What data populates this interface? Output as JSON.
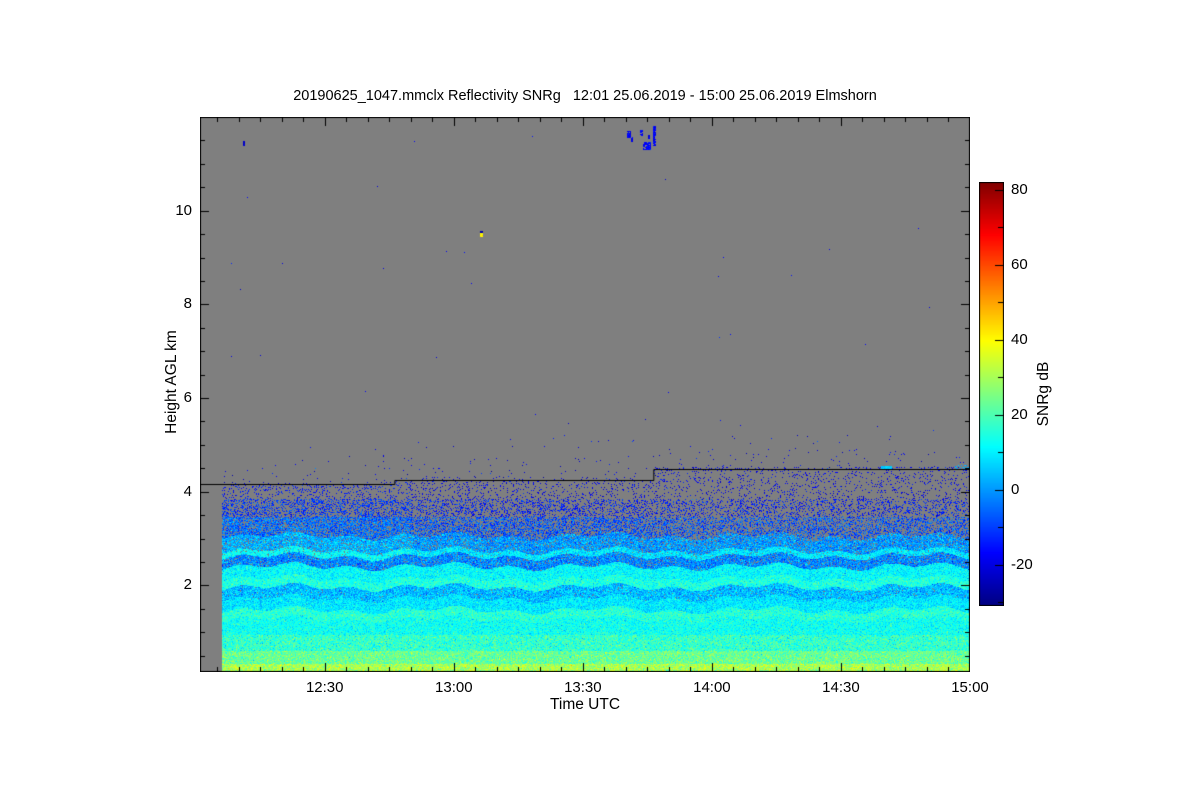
{
  "chart_data": {
    "type": "heatmap",
    "title": "20190625_1047.mmclx Reflectivity SNRg   12:01 25.06.2019 - 15:00 25.06.2019 Elmshorn",
    "xlabel": "Time UTC",
    "ylabel": "Height AGL km",
    "x_axis": {
      "start_min": 721,
      "end_min": 900,
      "minor_step_min": 5,
      "major_ticks": [
        {
          "label": "12:30",
          "min": 750
        },
        {
          "label": "13:00",
          "min": 780
        },
        {
          "label": "13:30",
          "min": 810
        },
        {
          "label": "14:00",
          "min": 840
        },
        {
          "label": "14:30",
          "min": 870
        },
        {
          "label": "15:00",
          "min": 900
        }
      ]
    },
    "y_axis": {
      "min_km": 0.15,
      "max_km": 12.0,
      "minor_step_km": 0.5,
      "major_ticks": [
        {
          "label": "2",
          "km": 2
        },
        {
          "label": "4",
          "km": 4
        },
        {
          "label": "6",
          "km": 6
        },
        {
          "label": "8",
          "km": 8
        },
        {
          "label": "10",
          "km": 10
        }
      ]
    },
    "colorbar": {
      "label": "SNRg dB",
      "vmin": -31,
      "vmax": 82,
      "minor_step": 10,
      "colormap": "jet",
      "major_ticks": [
        {
          "label": "80",
          "v": 80
        },
        {
          "label": "60",
          "v": 60
        },
        {
          "label": "40",
          "v": 40
        },
        {
          "label": "20",
          "v": 20
        },
        {
          "label": "0",
          "v": 0
        },
        {
          "label": "-20",
          "v": -20
        }
      ]
    },
    "no_signal_color": "#7f7f7f",
    "axis_color": "#000000",
    "data_start_min": 726.1,
    "cloud_top_line": {
      "color": "#000000",
      "segments": [
        {
          "t0": 721.0,
          "t1": 766.3,
          "h_km": 4.16
        },
        {
          "t0": 766.3,
          "t1": 826.5,
          "h_km": 4.26
        },
        {
          "t0": 826.5,
          "t1": 900.0,
          "h_km": 4.48
        }
      ]
    },
    "profile_layers": [
      {
        "h0": 0.15,
        "h1": 0.32,
        "snr": 30,
        "sig": 5,
        "cov": 1
      },
      {
        "h0": 0.32,
        "h1": 0.6,
        "snr": 23,
        "sig": 5,
        "cov": 1
      },
      {
        "h0": 0.6,
        "h1": 0.95,
        "snr": 17,
        "sig": 5,
        "cov": 1
      },
      {
        "h0": 0.95,
        "h1": 1.28,
        "snr": 13,
        "sig": 4,
        "cov": 1
      },
      {
        "h0": 1.28,
        "h1": 1.47,
        "snr": 16,
        "sig": 4,
        "cov": 1
      },
      {
        "h0": 1.47,
        "h1": 1.72,
        "snr": 9,
        "sig": 4,
        "cov": 1
      },
      {
        "h0": 1.72,
        "h1": 1.96,
        "snr": 4,
        "sig": 5,
        "cov": 0.97
      },
      {
        "h0": 1.96,
        "h1": 2.14,
        "snr": 15,
        "sig": 4,
        "cov": 1
      },
      {
        "h0": 2.14,
        "h1": 2.4,
        "snr": 11,
        "sig": 4,
        "cov": 1
      },
      {
        "h0": 2.4,
        "h1": 2.62,
        "snr": -2,
        "sig": 5,
        "cov": 0.88
      },
      {
        "h0": 2.62,
        "h1": 2.74,
        "snr": 9,
        "sig": 4,
        "cov": 0.95
      },
      {
        "h0": 2.74,
        "h1": 3.05,
        "snr": 0,
        "sig": 5,
        "cov": 0.85
      },
      {
        "h0": 3.05,
        "h1": 3.45,
        "snr": -8,
        "sig": 5,
        "cov": 0.5
      },
      {
        "h0": 3.45,
        "h1": 3.85,
        "snr": -14,
        "sig": 4,
        "cov": 0.28
      },
      {
        "h0": 3.85,
        "h1": 4.6,
        "snr": -18,
        "sig": 3,
        "cov": 0.1
      }
    ],
    "coverage_time_mult": [
      {
        "t_max": 770,
        "mult": 1.4
      },
      {
        "t_max": 830,
        "mult": 1.0
      },
      {
        "t_max": 901,
        "mult": 0.85
      }
    ],
    "left_enhance_t_max": 770,
    "left_enhance_db": 3,
    "wave": {
      "amp1": 0.05,
      "freq1": 0.5,
      "amp2": 0.05,
      "freq2": 0.17,
      "phase2": 1.3,
      "h_min": 1.2,
      "h_max": 3.3
    },
    "above_line_specks": {
      "hug_dh": 0.055,
      "near_dh": 0.45,
      "mid_dh": 0.95,
      "hug_prob_seg3": 0.16,
      "hug_prob_default": 0.05,
      "near_prob": 0.01,
      "mid_prob": 0.0022,
      "far_prob": 0.00012,
      "snr_mean": -19,
      "snr_sigma": 3.5
    },
    "features": [
      {
        "t0": 820.2,
        "t1": 820.9,
        "h0": 11.58,
        "h1": 11.7,
        "snr": -18,
        "prob": 0.8
      },
      {
        "t0": 821.1,
        "t1": 821.5,
        "h0": 11.48,
        "h1": 11.58,
        "snr": -20,
        "prob": 0.7
      },
      {
        "t0": 823.3,
        "t1": 823.8,
        "h0": 11.62,
        "h1": 11.72,
        "snr": -17,
        "prob": 0.6
      },
      {
        "t0": 824.0,
        "t1": 825.7,
        "h0": 11.32,
        "h1": 11.46,
        "snr": -16,
        "prob": 0.85
      },
      {
        "t0": 826.2,
        "t1": 826.8,
        "h0": 11.4,
        "h1": 11.8,
        "snr": -18,
        "prob": 0.8
      },
      {
        "t0": 825.1,
        "t1": 825.4,
        "h0": 11.52,
        "h1": 11.62,
        "snr": -21,
        "prob": 0.5
      },
      {
        "t0": 730.9,
        "t1": 731.3,
        "h0": 11.4,
        "h1": 11.48,
        "snr": -22,
        "prob": 1
      },
      {
        "t0": 786.2,
        "t1": 786.6,
        "h0": 9.52,
        "h1": 9.57,
        "snr": -27,
        "prob": 1
      },
      {
        "t0": 786.2,
        "t1": 786.6,
        "h0": 9.46,
        "h1": 9.52,
        "snr": 40,
        "prob": 1
      },
      {
        "t0": 879.3,
        "t1": 881.6,
        "h0": 4.5,
        "h1": 4.55,
        "snr": 6,
        "prob": 0.9
      },
      {
        "t0": 896.5,
        "t1": 899.5,
        "h0": 4.5,
        "h1": 4.58,
        "snr": 2,
        "prob": 0.4
      }
    ],
    "noise_seed": 1337
  }
}
